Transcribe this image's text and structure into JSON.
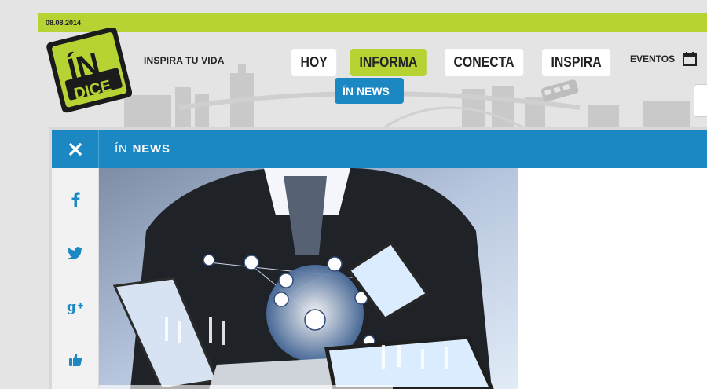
{
  "topbar": {
    "date": "08.08.2014"
  },
  "header": {
    "logo_text_top": "ÍN",
    "logo_text_bottom": "DICE",
    "tagline": "INSPIRA TU VIDA",
    "nav": [
      {
        "label": "HOY",
        "active": false
      },
      {
        "label": "INFORMA",
        "active": true
      },
      {
        "label": "CONECTA",
        "active": false
      },
      {
        "label": "INSPIRA",
        "active": false
      }
    ],
    "subnav": {
      "label": "ÍN NEWS"
    },
    "events_label": "EVENTOS",
    "events_icon": "calendar-icon"
  },
  "section": {
    "prefix": "ÍN",
    "title": "NEWS",
    "close_icon": "close-icon"
  },
  "share": [
    {
      "icon": "facebook-icon"
    },
    {
      "icon": "twitter-icon"
    },
    {
      "icon": "google-plus-icon"
    },
    {
      "icon": "thumbs-up-icon"
    }
  ],
  "colors": {
    "brand_green": "#b6d334",
    "brand_blue": "#1b87c3",
    "logo_dark": "#1b1b1b"
  }
}
